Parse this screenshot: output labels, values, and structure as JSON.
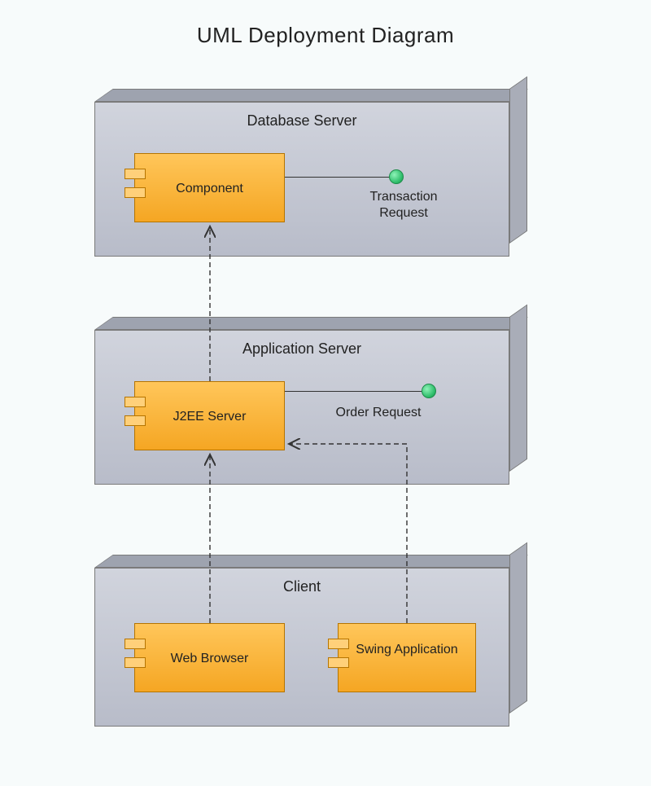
{
  "title": "UML Deployment Diagram",
  "nodes": {
    "db": {
      "label": "Database Server",
      "components": [
        {
          "name": "Component",
          "interface": "Transaction Request"
        }
      ]
    },
    "app": {
      "label": "Application Server",
      "components": [
        {
          "name": "J2EE Server",
          "interface": "Order Request"
        }
      ]
    },
    "client": {
      "label": "Client",
      "components": [
        {
          "name": "Web Browser"
        },
        {
          "name": "Swing Application"
        }
      ]
    }
  },
  "dependencies": [
    {
      "from": "J2EE Server",
      "to": "Component"
    },
    {
      "from": "Web Browser",
      "to": "J2EE Server"
    },
    {
      "from": "Swing Application",
      "to": "J2EE Server (interface)"
    }
  ],
  "colors": {
    "nodeFill": "#c4c8d4",
    "componentFill": "#f5a623",
    "interfaceFill": "#2ebd6a",
    "background": "#f7fbfb"
  }
}
